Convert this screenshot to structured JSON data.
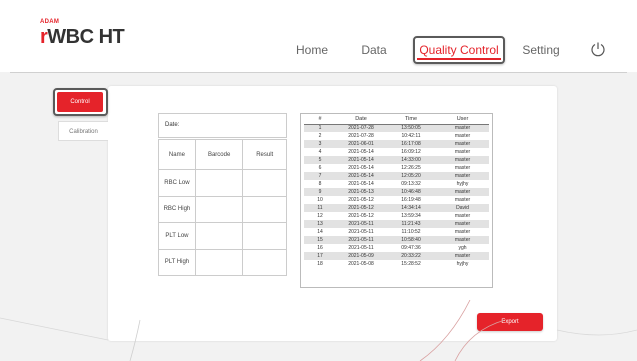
{
  "brand": {
    "top_label": "ADAM",
    "r_letter": "r",
    "name": "WBC HT"
  },
  "nav": {
    "items": [
      "Home",
      "Data",
      "Quality Control",
      "Setting"
    ],
    "active": "Quality Control",
    "power_icon": "power-icon"
  },
  "sidebar": {
    "items": [
      "Control",
      "Calibration"
    ],
    "active": "Control"
  },
  "form": {
    "date_label": "Date:",
    "headers": [
      "Name",
      "Barcode",
      "Result"
    ],
    "rows": [
      "RBC Low",
      "RBC High",
      "PLT Low",
      "PLT High"
    ]
  },
  "records": {
    "headers": [
      "#",
      "Date",
      "Time",
      "User"
    ],
    "rows": [
      [
        "1",
        "2021-07-28",
        "13:50:05",
        "master"
      ],
      [
        "2",
        "2021-07-28",
        "10:42:11",
        "master"
      ],
      [
        "3",
        "2021-06-01",
        "16:17:08",
        "master"
      ],
      [
        "4",
        "2021-05-14",
        "16:09:12",
        "master"
      ],
      [
        "5",
        "2021-05-14",
        "14:33:00",
        "master"
      ],
      [
        "6",
        "2021-05-14",
        "12:26:25",
        "master"
      ],
      [
        "7",
        "2021-05-14",
        "12:05:20",
        "master"
      ],
      [
        "8",
        "2021-05-14",
        "09:13:32",
        "hyjhy"
      ],
      [
        "9",
        "2021-05-13",
        "10:46:48",
        "master"
      ],
      [
        "10",
        "2021-05-12",
        "16:19:48",
        "master"
      ],
      [
        "11",
        "2021-05-12",
        "14:34:14",
        "David"
      ],
      [
        "12",
        "2021-05-12",
        "13:59:34",
        "master"
      ],
      [
        "13",
        "2021-05-11",
        "11:21:43",
        "master"
      ],
      [
        "14",
        "2021-05-11",
        "11:10:52",
        "master"
      ],
      [
        "15",
        "2021-05-11",
        "10:58:40",
        "master"
      ],
      [
        "16",
        "2021-05-11",
        "09:47:36",
        "ygh"
      ],
      [
        "17",
        "2021-05-09",
        "20:33:22",
        "master"
      ],
      [
        "18",
        "2021-05-08",
        "15:28:52",
        "hyjhy"
      ]
    ]
  },
  "export_label": "Export",
  "colors": {
    "accent": "#e5232a",
    "text": "#333333",
    "background": "#f2f2f2"
  }
}
